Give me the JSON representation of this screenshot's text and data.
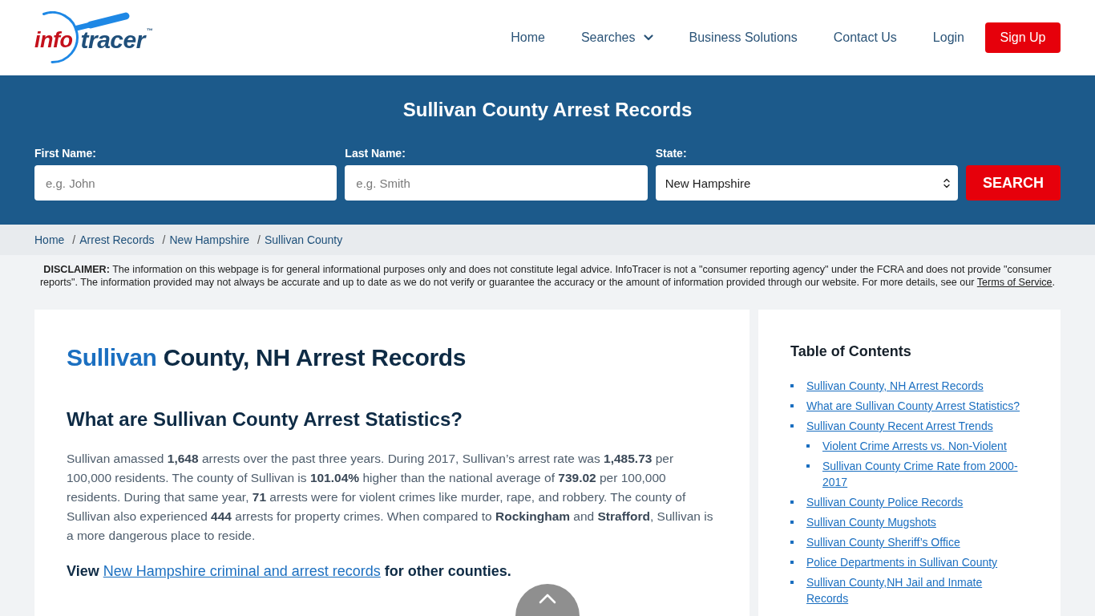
{
  "header": {
    "logo": {
      "first": "info",
      "second": "tracer",
      "mark": "™"
    },
    "nav": [
      {
        "label": "Home",
        "kind": "link"
      },
      {
        "label": "Searches",
        "kind": "dropdown"
      },
      {
        "label": "Business Solutions",
        "kind": "link"
      },
      {
        "label": "Contact Us",
        "kind": "link"
      },
      {
        "label": "Login",
        "kind": "link"
      },
      {
        "label": "Sign Up",
        "kind": "button"
      }
    ]
  },
  "search": {
    "title": "Sullivan County Arrest Records",
    "fields": [
      {
        "kind": "text",
        "label": "First Name:",
        "placeholder": "e.g. John"
      },
      {
        "kind": "text",
        "label": "Last Name:",
        "placeholder": "e.g. Smith"
      },
      {
        "kind": "select",
        "label": "State:",
        "value": "New Hampshire"
      }
    ],
    "button": "SEARCH"
  },
  "breadcrumb": {
    "separator": "/",
    "items": [
      "Home",
      "Arrest Records",
      "New Hampshire",
      "Sullivan County"
    ]
  },
  "disclaimer": {
    "text": "**DISCLAIMER:** The information on this webpage is for general informational purposes only and does not constitute legal advice. InfoTracer is not a \"consumer reporting agency\" under the FCRA and does not provide \"consumer reports\". The information provided may not always be accurate and up to date as we do not verify or guarantee the accuracy or the amount of information provided through our website. For more details, see our",
    "link": "Terms of Service",
    "end": "."
  },
  "article": {
    "title": {
      "highlight": "Sullivan",
      "rest": "County, NH Arrest Records"
    },
    "heading": "What are Sullivan County Arrest Statistics?",
    "paragraph": "Sullivan amassed **1,648** arrests over the past three years. During 2017, Sullivan’s arrest rate was **1,485.73** per 100,000 residents. The county of Sullivan is **101.04%** higher than the national average of **739.02** per 100,000 residents. During that same year, **71** arrests were for violent crimes like murder, rape, and robbery. The county of Sullivan also experienced **444** arrests for property crimes. When compared to **Rockingham** and **Strafford**, Sullivan is a more dangerous place to reside.",
    "view": {
      "before": "View",
      "link": "New Hampshire criminal and arrest records",
      "after": "for other counties."
    }
  },
  "toc": {
    "title": "Table of Contents",
    "items": [
      {
        "label": "Sullivan County, NH Arrest Records"
      },
      {
        "label": "What are Sullivan County Arrest Statistics?"
      },
      {
        "label": "Sullivan County Recent Arrest Trends",
        "children": [
          {
            "label": "Violent Crime Arrests vs. Non-Violent"
          },
          {
            "label": "Sullivan County Crime Rate from 2000-2017"
          }
        ]
      },
      {
        "label": "Sullivan County Police Records"
      },
      {
        "label": "Sullivan County Mugshots"
      },
      {
        "label": "Sullivan County Sheriff’s Office"
      },
      {
        "label": "Police Departments in Sullivan County"
      },
      {
        "label": "Sullivan County,NH Jail and Inmate Records"
      }
    ]
  }
}
